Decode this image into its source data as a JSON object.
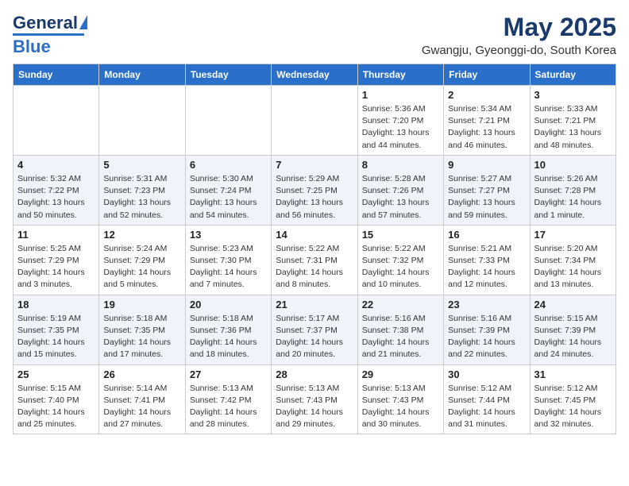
{
  "header": {
    "logo_general": "General",
    "logo_blue": "Blue",
    "title": "May 2025",
    "location": "Gwangju, Gyeonggi-do, South Korea"
  },
  "days_of_week": [
    "Sunday",
    "Monday",
    "Tuesday",
    "Wednesday",
    "Thursday",
    "Friday",
    "Saturday"
  ],
  "weeks": [
    [
      {
        "day": "",
        "info": ""
      },
      {
        "day": "",
        "info": ""
      },
      {
        "day": "",
        "info": ""
      },
      {
        "day": "",
        "info": ""
      },
      {
        "day": "1",
        "info": "Sunrise: 5:36 AM\nSunset: 7:20 PM\nDaylight: 13 hours\nand 44 minutes."
      },
      {
        "day": "2",
        "info": "Sunrise: 5:34 AM\nSunset: 7:21 PM\nDaylight: 13 hours\nand 46 minutes."
      },
      {
        "day": "3",
        "info": "Sunrise: 5:33 AM\nSunset: 7:21 PM\nDaylight: 13 hours\nand 48 minutes."
      }
    ],
    [
      {
        "day": "4",
        "info": "Sunrise: 5:32 AM\nSunset: 7:22 PM\nDaylight: 13 hours\nand 50 minutes."
      },
      {
        "day": "5",
        "info": "Sunrise: 5:31 AM\nSunset: 7:23 PM\nDaylight: 13 hours\nand 52 minutes."
      },
      {
        "day": "6",
        "info": "Sunrise: 5:30 AM\nSunset: 7:24 PM\nDaylight: 13 hours\nand 54 minutes."
      },
      {
        "day": "7",
        "info": "Sunrise: 5:29 AM\nSunset: 7:25 PM\nDaylight: 13 hours\nand 56 minutes."
      },
      {
        "day": "8",
        "info": "Sunrise: 5:28 AM\nSunset: 7:26 PM\nDaylight: 13 hours\nand 57 minutes."
      },
      {
        "day": "9",
        "info": "Sunrise: 5:27 AM\nSunset: 7:27 PM\nDaylight: 13 hours\nand 59 minutes."
      },
      {
        "day": "10",
        "info": "Sunrise: 5:26 AM\nSunset: 7:28 PM\nDaylight: 14 hours\nand 1 minute."
      }
    ],
    [
      {
        "day": "11",
        "info": "Sunrise: 5:25 AM\nSunset: 7:29 PM\nDaylight: 14 hours\nand 3 minutes."
      },
      {
        "day": "12",
        "info": "Sunrise: 5:24 AM\nSunset: 7:29 PM\nDaylight: 14 hours\nand 5 minutes."
      },
      {
        "day": "13",
        "info": "Sunrise: 5:23 AM\nSunset: 7:30 PM\nDaylight: 14 hours\nand 7 minutes."
      },
      {
        "day": "14",
        "info": "Sunrise: 5:22 AM\nSunset: 7:31 PM\nDaylight: 14 hours\nand 8 minutes."
      },
      {
        "day": "15",
        "info": "Sunrise: 5:22 AM\nSunset: 7:32 PM\nDaylight: 14 hours\nand 10 minutes."
      },
      {
        "day": "16",
        "info": "Sunrise: 5:21 AM\nSunset: 7:33 PM\nDaylight: 14 hours\nand 12 minutes."
      },
      {
        "day": "17",
        "info": "Sunrise: 5:20 AM\nSunset: 7:34 PM\nDaylight: 14 hours\nand 13 minutes."
      }
    ],
    [
      {
        "day": "18",
        "info": "Sunrise: 5:19 AM\nSunset: 7:35 PM\nDaylight: 14 hours\nand 15 minutes."
      },
      {
        "day": "19",
        "info": "Sunrise: 5:18 AM\nSunset: 7:35 PM\nDaylight: 14 hours\nand 17 minutes."
      },
      {
        "day": "20",
        "info": "Sunrise: 5:18 AM\nSunset: 7:36 PM\nDaylight: 14 hours\nand 18 minutes."
      },
      {
        "day": "21",
        "info": "Sunrise: 5:17 AM\nSunset: 7:37 PM\nDaylight: 14 hours\nand 20 minutes."
      },
      {
        "day": "22",
        "info": "Sunrise: 5:16 AM\nSunset: 7:38 PM\nDaylight: 14 hours\nand 21 minutes."
      },
      {
        "day": "23",
        "info": "Sunrise: 5:16 AM\nSunset: 7:39 PM\nDaylight: 14 hours\nand 22 minutes."
      },
      {
        "day": "24",
        "info": "Sunrise: 5:15 AM\nSunset: 7:39 PM\nDaylight: 14 hours\nand 24 minutes."
      }
    ],
    [
      {
        "day": "25",
        "info": "Sunrise: 5:15 AM\nSunset: 7:40 PM\nDaylight: 14 hours\nand 25 minutes."
      },
      {
        "day": "26",
        "info": "Sunrise: 5:14 AM\nSunset: 7:41 PM\nDaylight: 14 hours\nand 27 minutes."
      },
      {
        "day": "27",
        "info": "Sunrise: 5:13 AM\nSunset: 7:42 PM\nDaylight: 14 hours\nand 28 minutes."
      },
      {
        "day": "28",
        "info": "Sunrise: 5:13 AM\nSunset: 7:43 PM\nDaylight: 14 hours\nand 29 minutes."
      },
      {
        "day": "29",
        "info": "Sunrise: 5:13 AM\nSunset: 7:43 PM\nDaylight: 14 hours\nand 30 minutes."
      },
      {
        "day": "30",
        "info": "Sunrise: 5:12 AM\nSunset: 7:44 PM\nDaylight: 14 hours\nand 31 minutes."
      },
      {
        "day": "31",
        "info": "Sunrise: 5:12 AM\nSunset: 7:45 PM\nDaylight: 14 hours\nand 32 minutes."
      }
    ]
  ]
}
